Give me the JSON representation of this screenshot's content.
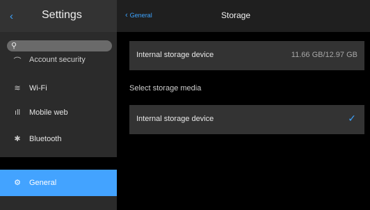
{
  "sidebar": {
    "title": "Settings",
    "back_glyph": "‹",
    "search_glyph": "⚲",
    "items": [
      {
        "label": "Account security",
        "icon": "person-icon",
        "glyph": "⌒"
      },
      {
        "label": "Wi-Fi",
        "icon": "wifi-icon",
        "glyph": "≋"
      },
      {
        "label": "Mobile web",
        "icon": "signal-icon",
        "glyph": "ıll"
      },
      {
        "label": "Bluetooth",
        "icon": "bluetooth-icon",
        "glyph": "✱"
      },
      {
        "label": "General",
        "icon": "gear-icon",
        "glyph": "⚙"
      }
    ]
  },
  "main": {
    "breadcrumb": "General",
    "breadcrumb_chevron": "‹",
    "title": "Storage",
    "storage_card": {
      "label": "Internal storage device",
      "value": "11.66 GB/12.97 GB"
    },
    "section_label": "Select storage media",
    "media_option": {
      "label": "Internal storage device",
      "check": "✓"
    }
  },
  "colors": {
    "accent": "#43a3ff",
    "sidebar_bg": "#2b2b2b",
    "card_bg": "#333333",
    "main_bg": "#000000"
  }
}
